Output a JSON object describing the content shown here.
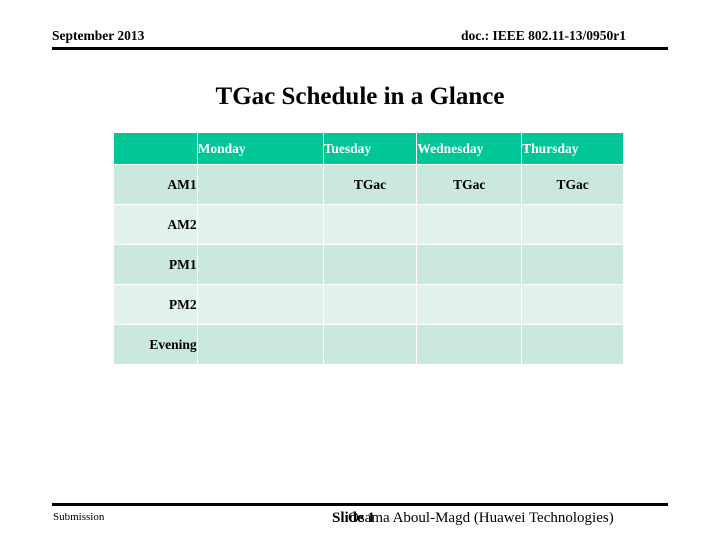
{
  "header": {
    "date": "September 2013",
    "doc": "doc.: IEEE 802.11-13/0950r1"
  },
  "title": "TGac Schedule in a Glance",
  "table": {
    "corner_label": "",
    "columns": [
      "Monday",
      "Tuesday",
      "Wednesday",
      "Thursday"
    ],
    "rows": [
      {
        "label": "AM1",
        "shade": "dark",
        "cells": [
          "",
          "TGac",
          "TGac",
          "TGac"
        ]
      },
      {
        "label": "AM2",
        "shade": "light",
        "cells": [
          "",
          "",
          "",
          ""
        ]
      },
      {
        "label": "PM1",
        "shade": "dark",
        "cells": [
          "",
          "",
          "",
          ""
        ]
      },
      {
        "label": "PM2",
        "shade": "light",
        "cells": [
          "",
          "",
          "",
          ""
        ]
      },
      {
        "label": "Evening",
        "shade": "dark",
        "cells": [
          "",
          "",
          "",
          ""
        ]
      }
    ]
  },
  "footer": {
    "left": "Submission",
    "slide": "Slide 1",
    "author": "Osama Aboul-Magd (Huawei Technologies)"
  },
  "colors": {
    "header_fill": "#00c795",
    "row_dark": "#cae8dc",
    "row_light": "#e4f2ec",
    "rule": "#000000",
    "header_text": "#ffffff"
  }
}
